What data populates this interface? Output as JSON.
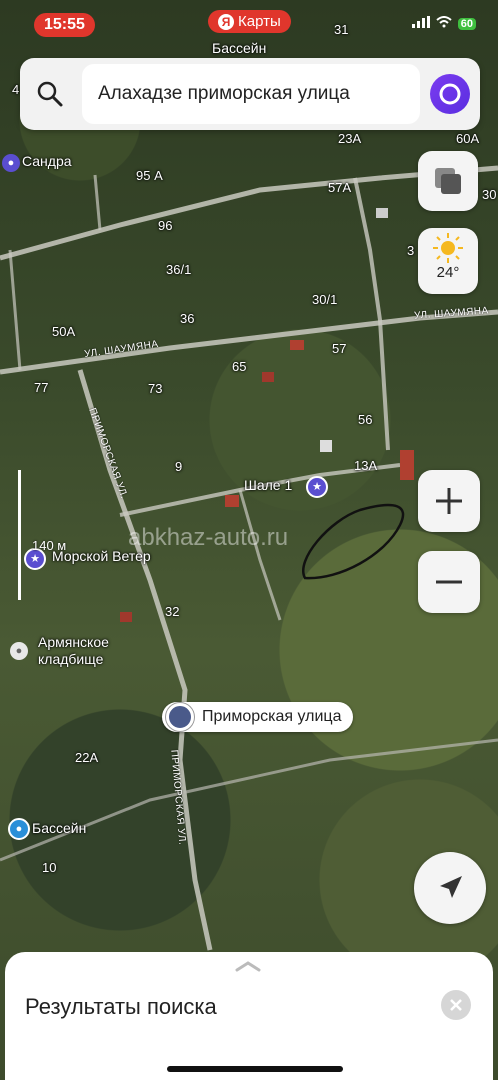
{
  "status_bar": {
    "time": "15:55",
    "app_pill": "Карты",
    "app_pill_logo": "Я",
    "battery": "60"
  },
  "search": {
    "query": "Алахадзе приморская улица"
  },
  "weather": {
    "temperature": "24°",
    "icon": "sun-icon"
  },
  "map": {
    "house_numbers": [
      "31",
      "4",
      "95 А",
      "57А",
      "96",
      "36/1",
      "30/1",
      "36",
      "50А",
      "57",
      "65",
      "77",
      "73",
      "56",
      "9",
      "13А",
      "32",
      "22А",
      "10",
      "23А",
      "60А",
      "30",
      "3"
    ],
    "places": {
      "top_pool": "Бассейн",
      "sandra": "Сандра",
      "shale": "Шале 1",
      "morskoy_veter": "Морской Ветер",
      "armenian_cemetery_line1": "Армянское",
      "armenian_cemetery_line2": "кладбище",
      "bottom_pool": "Бассейн"
    },
    "roads": {
      "shaumyana_left": "УЛ. ШАУМЯНА",
      "shaumyana_right": "УЛ. ШАУМЯНА",
      "primorskaya_upper": "ПРИМОРСКАЯ УЛ.",
      "primorskaya_lower": "ПРИМОРСКАЯ УЛ."
    },
    "scale_label": "140 м",
    "selected_pin_label": "Приморская улица",
    "watermark": "abkhaz-auto.ru"
  },
  "bottom_sheet": {
    "title": "Результаты поиска"
  }
}
